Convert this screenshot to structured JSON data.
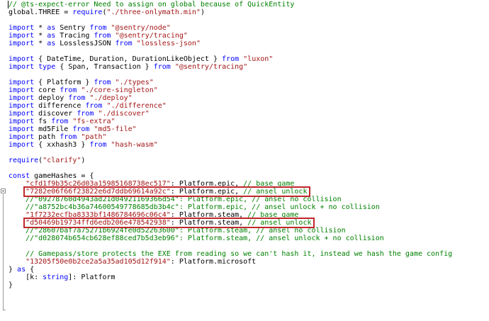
{
  "code_lines": [
    [
      {
        "c": "cm",
        "t": "// @ts-expect-error Need to assign on global because of QuickEntity"
      }
    ],
    [
      {
        "c": "",
        "t": "global.THREE = "
      },
      {
        "c": "kw",
        "t": "require"
      },
      {
        "c": "",
        "t": "("
      },
      {
        "c": "str",
        "t": "\"./three-onlymath.min\""
      },
      {
        "c": "",
        "t": ")"
      }
    ],
    [
      {
        "c": "",
        "t": ""
      }
    ],
    [
      {
        "c": "kw",
        "t": "import"
      },
      {
        "c": "",
        "t": " * "
      },
      {
        "c": "kw",
        "t": "as"
      },
      {
        "c": "",
        "t": " Sentry "
      },
      {
        "c": "kw",
        "t": "from"
      },
      {
        "c": "",
        "t": " "
      },
      {
        "c": "str",
        "t": "\"@sentry/node\""
      }
    ],
    [
      {
        "c": "kw",
        "t": "import"
      },
      {
        "c": "",
        "t": " * "
      },
      {
        "c": "kw",
        "t": "as"
      },
      {
        "c": "",
        "t": " Tracing "
      },
      {
        "c": "kw",
        "t": "from"
      },
      {
        "c": "",
        "t": " "
      },
      {
        "c": "str",
        "t": "\"@sentry/tracing\""
      }
    ],
    [
      {
        "c": "kw",
        "t": "import"
      },
      {
        "c": "",
        "t": " * "
      },
      {
        "c": "kw",
        "t": "as"
      },
      {
        "c": "",
        "t": " LosslessJSON "
      },
      {
        "c": "kw",
        "t": "from"
      },
      {
        "c": "",
        "t": " "
      },
      {
        "c": "str",
        "t": "\"lossless-json\""
      }
    ],
    [
      {
        "c": "",
        "t": ""
      }
    ],
    [
      {
        "c": "kw",
        "t": "import"
      },
      {
        "c": "",
        "t": " { DateTime, Duration, DurationLikeObject } "
      },
      {
        "c": "kw",
        "t": "from"
      },
      {
        "c": "",
        "t": " "
      },
      {
        "c": "str",
        "t": "\"luxon\""
      }
    ],
    [
      {
        "c": "kw",
        "t": "import"
      },
      {
        "c": "",
        "t": " "
      },
      {
        "c": "kw",
        "t": "type"
      },
      {
        "c": "",
        "t": " { Span, Transaction } "
      },
      {
        "c": "kw",
        "t": "from"
      },
      {
        "c": "",
        "t": " "
      },
      {
        "c": "str",
        "t": "\"@sentry/tracing\""
      }
    ],
    [
      {
        "c": "",
        "t": ""
      }
    ],
    [
      {
        "c": "kw",
        "t": "import"
      },
      {
        "c": "",
        "t": " { Platform } "
      },
      {
        "c": "kw",
        "t": "from"
      },
      {
        "c": "",
        "t": " "
      },
      {
        "c": "str",
        "t": "\"./types\""
      }
    ],
    [
      {
        "c": "kw",
        "t": "import"
      },
      {
        "c": "",
        "t": " core "
      },
      {
        "c": "kw",
        "t": "from"
      },
      {
        "c": "",
        "t": " "
      },
      {
        "c": "str",
        "t": "\"./core-singleton\""
      }
    ],
    [
      {
        "c": "kw",
        "t": "import"
      },
      {
        "c": "",
        "t": " deploy "
      },
      {
        "c": "kw",
        "t": "from"
      },
      {
        "c": "",
        "t": " "
      },
      {
        "c": "str",
        "t": "\"./deploy\""
      }
    ],
    [
      {
        "c": "kw",
        "t": "import"
      },
      {
        "c": "",
        "t": " difference "
      },
      {
        "c": "kw",
        "t": "from"
      },
      {
        "c": "",
        "t": " "
      },
      {
        "c": "str",
        "t": "\"./difference\""
      }
    ],
    [
      {
        "c": "kw",
        "t": "import"
      },
      {
        "c": "",
        "t": " discover "
      },
      {
        "c": "kw",
        "t": "from"
      },
      {
        "c": "",
        "t": " "
      },
      {
        "c": "str",
        "t": "\"./discover\""
      }
    ],
    [
      {
        "c": "kw",
        "t": "import"
      },
      {
        "c": "",
        "t": " fs "
      },
      {
        "c": "kw",
        "t": "from"
      },
      {
        "c": "",
        "t": " "
      },
      {
        "c": "str",
        "t": "\"fs-extra\""
      }
    ],
    [
      {
        "c": "kw",
        "t": "import"
      },
      {
        "c": "",
        "t": " md5File "
      },
      {
        "c": "kw",
        "t": "from"
      },
      {
        "c": "",
        "t": " "
      },
      {
        "c": "str",
        "t": "\"md5-file\""
      }
    ],
    [
      {
        "c": "kw",
        "t": "import"
      },
      {
        "c": "",
        "t": " path "
      },
      {
        "c": "kw",
        "t": "from"
      },
      {
        "c": "",
        "t": " "
      },
      {
        "c": "str",
        "t": "\"path\""
      }
    ],
    [
      {
        "c": "kw",
        "t": "import"
      },
      {
        "c": "",
        "t": " { xxhash3 } "
      },
      {
        "c": "kw",
        "t": "from"
      },
      {
        "c": "",
        "t": " "
      },
      {
        "c": "str",
        "t": "\"hash-wasm\""
      }
    ],
    [
      {
        "c": "",
        "t": ""
      }
    ],
    [
      {
        "c": "kw",
        "t": "require"
      },
      {
        "c": "",
        "t": "("
      },
      {
        "c": "str",
        "t": "\"clarify\""
      },
      {
        "c": "",
        "t": ")"
      }
    ],
    [
      {
        "c": "",
        "t": ""
      }
    ],
    [
      {
        "c": "kw",
        "t": "const"
      },
      {
        "c": "",
        "t": " gameHashes = {"
      }
    ],
    [
      {
        "c": "",
        "t": "    "
      },
      {
        "c": "str",
        "t": "\"cfd1f9b35c26d03a15985168738ec517\""
      },
      {
        "c": "",
        "t": ": Platform.epic, "
      },
      {
        "c": "cm",
        "t": "// base game"
      }
    ],
    [
      {
        "c": "",
        "t": "    "
      },
      {
        "c": "str",
        "t": "\"7282e06f66f23822e6d7ddb69614a92c\""
      },
      {
        "c": "",
        "t": ": Platform.epic, "
      },
      {
        "c": "cm",
        "t": "// ansel unlock"
      }
    ],
    [
      {
        "c": "cm",
        "t": "    //\"09278760d4943ad21d04921169366d54\": Platform.epic, // ansel no collision"
      }
    ],
    [
      {
        "c": "cm",
        "t": "    //\"a8752bc4b36a74600549778685db3b4c\": Platform.epic, // ansel unlock + no collision"
      }
    ],
    [
      {
        "c": "",
        "t": "    "
      },
      {
        "c": "str",
        "t": "\"1f7232ecfba8333bf1486784696c06c4\""
      },
      {
        "c": "",
        "t": ": Platform.steam, "
      },
      {
        "c": "cm",
        "t": "// base game"
      }
    ],
    [
      {
        "c": "",
        "t": "    "
      },
      {
        "c": "str",
        "t": "\"d50469b19734ffd6edb206e478542938\""
      },
      {
        "c": "",
        "t": ": Platform.steam, "
      },
      {
        "c": "cm",
        "t": "// ansel unlock"
      }
    ],
    [
      {
        "c": "cm",
        "t": "    //\"28607baf7a75271b6924fe0d52263600\": Platform.steam, // ansel no collision"
      }
    ],
    [
      {
        "c": "cm",
        "t": "    //\"d028074b654cb628ef88ced7b5d3eb96\": Platform.steam, // ansel unlock + no collision"
      }
    ],
    [
      {
        "c": "",
        "t": ""
      }
    ],
    [
      {
        "c": "cm",
        "t": "    // Gamepass/store protects the EXE from reading so we can't hash it, instead we hash the game config"
      }
    ],
    [
      {
        "c": "",
        "t": "    "
      },
      {
        "c": "str",
        "t": "\"13205f50e0b2ce2a5a35ad105d12f914\""
      },
      {
        "c": "",
        "t": ": Platform.microsoft"
      }
    ],
    [
      {
        "c": "",
        "t": "} "
      },
      {
        "c": "kw",
        "t": "as"
      },
      {
        "c": "",
        "t": " {"
      }
    ],
    [
      {
        "c": "",
        "t": "    [k: "
      },
      {
        "c": "kw",
        "t": "string"
      },
      {
        "c": "",
        "t": "]: Platform"
      }
    ],
    [
      {
        "c": "",
        "t": "}"
      }
    ]
  ],
  "colors": {
    "keyword": "#0000ff",
    "string": "#a31515",
    "comment": "#008000",
    "highlight_box": "#c0272d"
  },
  "highlighted_lines": [
    24,
    28
  ],
  "highlighted_line_texts": [
    "\"7282e06f66f23822e6d7ddb69614a92c\": Platform.epic, // ansel unlock",
    "\"d50469b19734ffd6edb206e478542938\": Platform.steam, // ansel unlock"
  ]
}
